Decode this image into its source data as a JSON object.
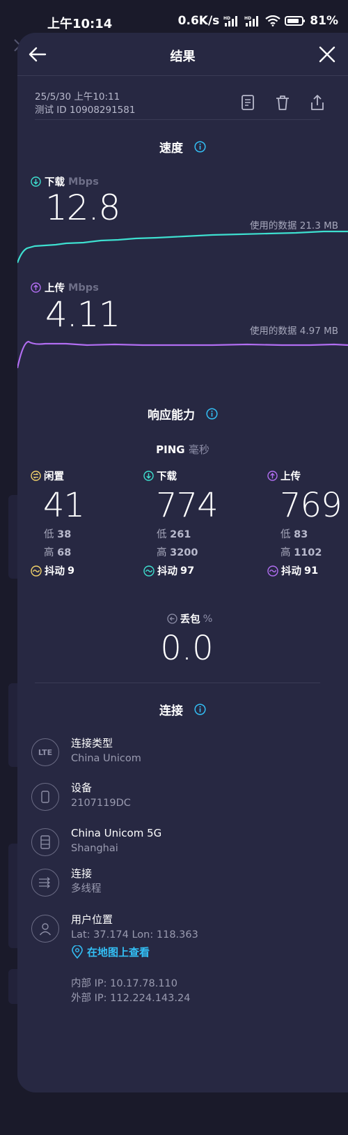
{
  "status_bar": {
    "time": "上午10:14",
    "net_speed": "0.6K/s",
    "battery": "81%",
    "icons": [
      "hd-signal-icon",
      "hd-signal-icon",
      "wifi-icon",
      "battery-icon"
    ]
  },
  "header": {
    "title": "结果",
    "back_icon": "arrow-left-icon",
    "close_icon": "close-icon"
  },
  "meta": {
    "date": "25/5/30 上午10:11",
    "test_id": "测试 ID 10908291581",
    "actions": [
      "document-icon",
      "trash-icon",
      "share-icon"
    ]
  },
  "speed": {
    "title": "速度",
    "download": {
      "label": "下载",
      "unit": "Mbps",
      "value": "12.8",
      "data_used": "使用的数据 21.3 MB",
      "color": "#3ee0d0"
    },
    "upload": {
      "label": "上传",
      "unit": "Mbps",
      "value": "4.11",
      "data_used": "使用的数据 4.97 MB",
      "color": "#b26ef2"
    }
  },
  "responsiveness": {
    "title": "响应能力",
    "ping_label": "PING",
    "ping_unit": "毫秒",
    "idle": {
      "label": "闲置",
      "value": "41",
      "low_label": "低",
      "low": "38",
      "high_label": "高",
      "high": "68",
      "jitter_label": "抖动",
      "jitter": "9",
      "color": "#f3d36b"
    },
    "download": {
      "label": "下载",
      "value": "774",
      "low_label": "低",
      "low": "261",
      "high_label": "高",
      "high": "3200",
      "jitter_label": "抖动",
      "jitter": "97",
      "color": "#3ee0d0"
    },
    "upload": {
      "label": "上传",
      "value": "769",
      "low_label": "低",
      "low": "83",
      "high_label": "高",
      "high": "1102",
      "jitter_label": "抖动",
      "jitter": "91",
      "color": "#b26ef2"
    },
    "packet_loss": {
      "label": "丢包",
      "unit": "%",
      "value": "0.0"
    }
  },
  "connection": {
    "title": "连接",
    "items": [
      {
        "icon": "lte-icon",
        "icon_text": "LTE",
        "line1": "连接类型",
        "line2": "China Unicom"
      },
      {
        "icon": "phone-icon",
        "line1": "设备",
        "line2": "2107119DC"
      },
      {
        "icon": "server-icon",
        "line1": "China Unicom 5G",
        "line2": "Shanghai"
      },
      {
        "icon": "multi-connection-icon",
        "line1": "连接",
        "line2": "多线程"
      },
      {
        "icon": "user-icon",
        "line1": "用户位置",
        "line2": "Lat: 37.174 Lon: 118.363"
      }
    ],
    "map_link": "在地图上查看",
    "internal_ip": "内部 IP: 10.17.78.110",
    "external_ip": "外部 IP: 112.224.143.24"
  },
  "colors": {
    "accent": "#33bff5",
    "download": "#3ee0d0",
    "upload": "#b26ef2",
    "idle": "#f3d36b",
    "sheet_bg": "#272842"
  }
}
